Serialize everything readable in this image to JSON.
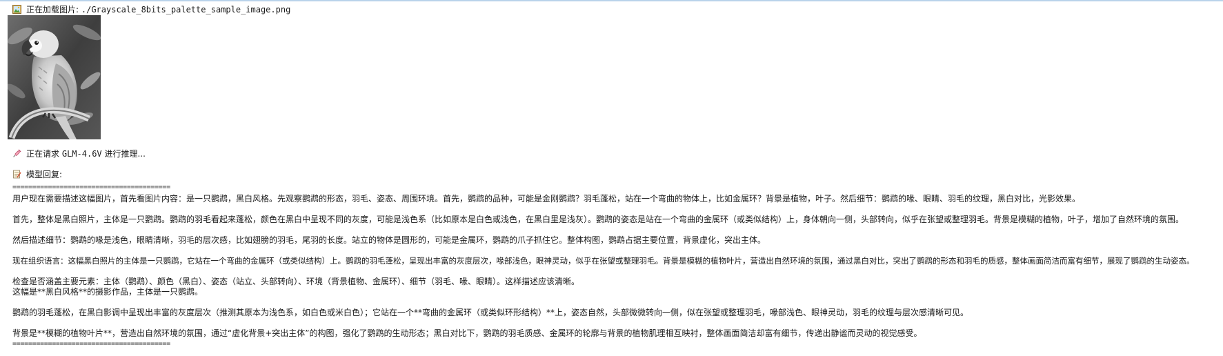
{
  "loading_line": {
    "label": "正在加载图片:",
    "path": "./Grayscale_8bits_palette_sample_image.png"
  },
  "request_line": {
    "label": "正在请求",
    "model": "GLM-4.6V",
    "suffix": "进行推理..."
  },
  "reply_header": "模型回复:",
  "separator": "========================================",
  "reasoning_paragraphs": [
    "用户现在需要描述这幅图片，首先看图片内容：是一只鹦鹉，黑白风格。先观察鹦鹉的形态，羽毛、姿态、周围环境。首先，鹦鹉的品种，可能是金刚鹦鹉？羽毛蓬松，站在一个弯曲的物体上，比如金属环？背景是植物，叶子。然后细节：鹦鹉的喙、眼睛、羽毛的纹理，黑白对比，光影效果。",
    "首先，整体是黑白照片，主体是一只鹦鹉。鹦鹉的羽毛看起来蓬松，颜色在黑白中呈现不同的灰度，可能是浅色系（比如原本是白色或浅色，在黑白里是浅灰）。鹦鹉的姿态是站在一个弯曲的金属环（或类似结构）上，身体朝向一侧，头部转向，似乎在张望或整理羽毛。背景是模糊的植物，叶子，增加了自然环境的氛围。",
    "然后描述细节：鹦鹉的喙是浅色，眼睛清晰，羽毛的层次感，比如翅膀的羽毛，尾羽的长度。站立的物体是圆形的，可能是金属环，鹦鹉的爪子抓住它。整体构图，鹦鹉占据主要位置，背景虚化，突出主体。",
    "现在组织语言：这幅黑白照片的主体是一只鹦鹉，它站在一个弯曲的金属环（或类似结构）上。鹦鹉的羽毛蓬松，呈现出丰富的灰度层次，喙部浅色，眼神灵动，似乎在张望或整理羽毛。背景是模糊的植物叶片，营造出自然环境的氛围，通过黑白对比，突出了鹦鹉的形态和羽毛的质感，整体画面简洁而富有细节，展现了鹦鹉的生动姿态。",
    "检查是否涵盖主要元素：主体（鹦鹉）、颜色（黑白）、姿态（站立、头部转向）、环境（背景植物、金属环）、细节（羽毛、喙、眼睛）。这样描述应该清晰。"
  ],
  "answer_paragraphs": [
    "这幅是**黑白风格**的摄影作品，主体是一只鹦鹉。",
    "鹦鹉的羽毛蓬松，在黑白影调中呈现出丰富的灰度层次（推测其原本为浅色系，如白色或米白色）；它站在一个**弯曲的金属环（或类似环形结构）**上，姿态自然，头部微微转向一侧，似在张望或整理羽毛，喙部浅色、眼神灵动，羽毛的纹理与层次感清晰可见。",
    "背景是**模糊的植物叶片**，营造出自然环境的氛围，通过“虚化背景+突出主体”的构图，强化了鹦鹉的生动形态；黑白对比下，鹦鹉的羽毛质感、金属环的轮廓与背景的植物肌理相互映衬，整体画面简洁却富有细节，传递出静谧而灵动的视觉感受。"
  ],
  "colors": {
    "top_border": "#b9d3ea",
    "text": "#1a1a1a"
  },
  "icons": {
    "loading": "framed-picture-icon",
    "request": "syringe-icon",
    "reply": "memo-icon"
  }
}
